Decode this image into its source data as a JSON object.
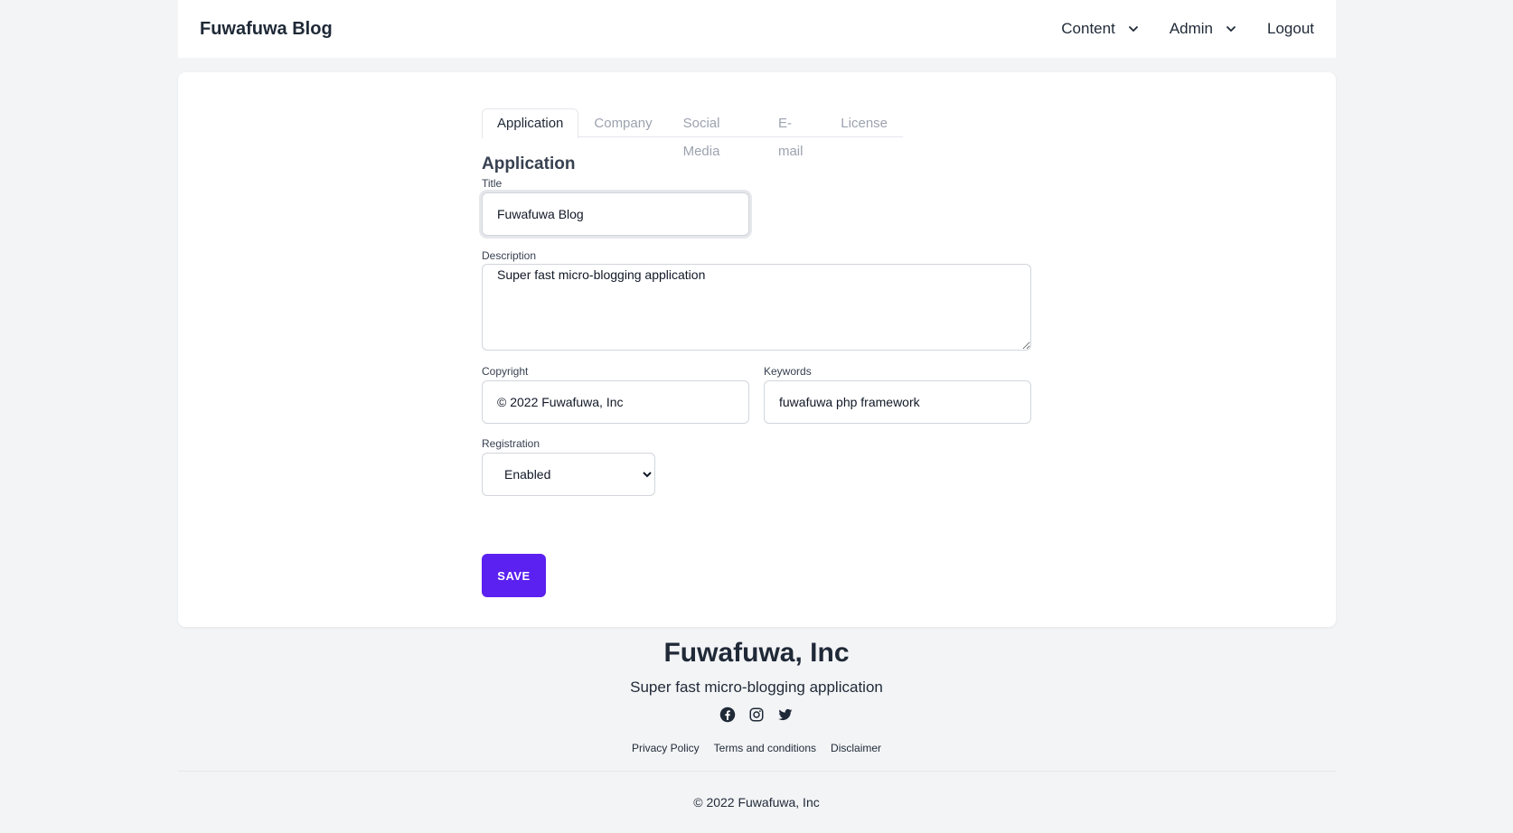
{
  "header": {
    "brand": "Fuwafuwa Blog",
    "nav": {
      "content": "Content",
      "admin": "Admin",
      "logout": "Logout"
    }
  },
  "tabs": [
    {
      "label": "Application",
      "active": true
    },
    {
      "label": "Company",
      "active": false
    },
    {
      "label": "Social Media",
      "active": false
    },
    {
      "label": "E-mail",
      "active": false
    },
    {
      "label": "License",
      "active": false
    }
  ],
  "form": {
    "section_title": "Application",
    "title": {
      "label": "Title",
      "value": "Fuwafuwa Blog"
    },
    "description": {
      "label": "Description",
      "value": "Super fast micro-blogging application"
    },
    "copyright": {
      "label": "Copyright",
      "value": "© 2022 Fuwafuwa, Inc"
    },
    "keywords": {
      "label": "Keywords",
      "value": "fuwafuwa php framework"
    },
    "registration": {
      "label": "Registration",
      "selected": "Enabled"
    },
    "save_label": "SAVE"
  },
  "footer": {
    "company": "Fuwafuwa, Inc",
    "description": "Super fast micro-blogging application",
    "social_icons": [
      "facebook-icon",
      "instagram-icon",
      "twitter-icon"
    ],
    "links": {
      "privacy": "Privacy Policy",
      "terms": "Terms and conditions",
      "disclaimer": "Disclaimer"
    },
    "copyright": "© 2022 Fuwafuwa, Inc"
  },
  "colors": {
    "accent": "#5b21f0",
    "background": "#f3f4f6"
  }
}
